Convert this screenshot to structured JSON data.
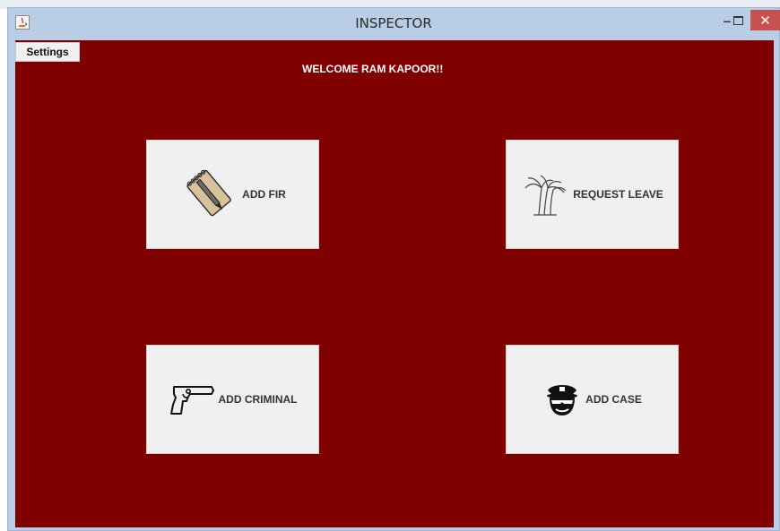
{
  "window": {
    "title": "INSPECTOR",
    "minimize": "‒",
    "close": "✕"
  },
  "menu": {
    "settings": "Settings"
  },
  "welcome_text": "WELCOME RAM KAPOOR!!",
  "actions": {
    "add_fir": {
      "label": "ADD FIR",
      "icon": "notepad-pencil-icon"
    },
    "request_leave": {
      "label": "REQUEST LEAVE",
      "icon": "palm-tree-icon"
    },
    "add_criminal": {
      "label": "ADD CRIMINAL",
      "icon": "pistol-icon"
    },
    "add_case": {
      "label": "ADD CASE",
      "icon": "police-officer-icon"
    }
  },
  "colors": {
    "content_background": "#800000",
    "window_frame": "#b9cde5",
    "close_button": "#c75050",
    "tile_background": "#f0f0f0"
  }
}
